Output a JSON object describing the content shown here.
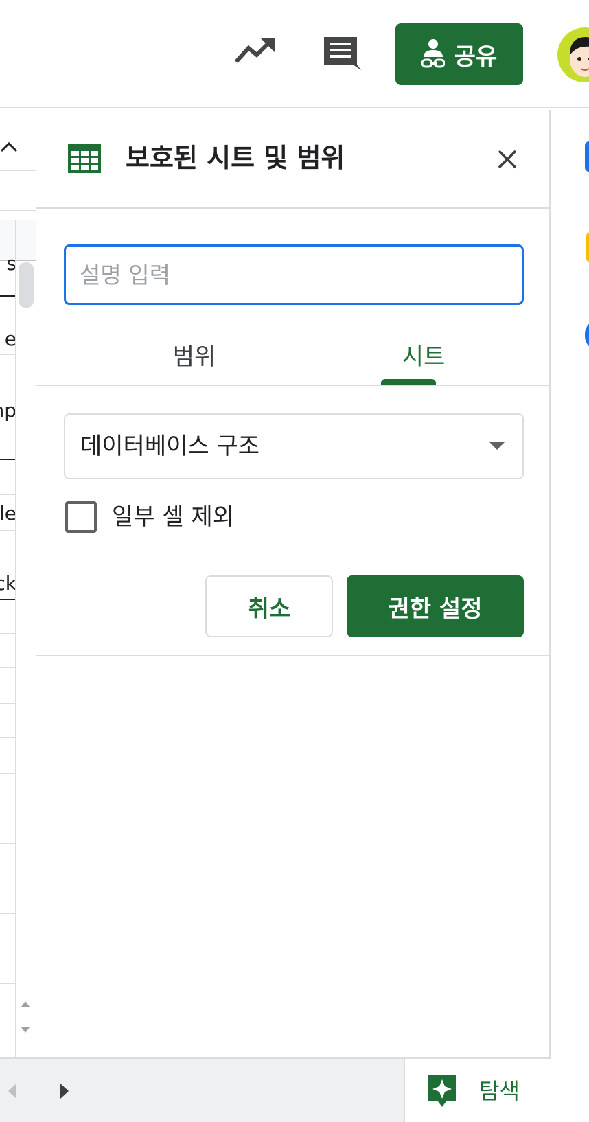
{
  "topbar": {
    "trend_icon": "trending-up-icon",
    "comment_icon": "comment-icon",
    "share_label": "공유",
    "share_icon": "person-link-icon",
    "avatar": "avatar"
  },
  "sheet_strip": {
    "cells": [
      "s",
      "e",
      "mp",
      "",
      "le",
      "ck"
    ]
  },
  "panel": {
    "title": "보호된 시트 및 범위",
    "description": {
      "placeholder": "설명 입력",
      "value": ""
    },
    "tabs": [
      {
        "label": "범위",
        "active": false
      },
      {
        "label": "시트",
        "active": true
      }
    ],
    "sheet_select": {
      "value": "데이터베이스 구조"
    },
    "exclude_cells": {
      "label": "일부 셀 제외",
      "checked": false
    },
    "buttons": {
      "cancel": "취소",
      "set_permissions": "권한 설정"
    }
  },
  "bottombar": {
    "explore_label": "탐색"
  },
  "colors": {
    "accent_green": "#1e6e35",
    "focus_blue": "#1a73e8",
    "border_gray": "#dadce0",
    "avatar_bg": "#c6dd2e"
  }
}
